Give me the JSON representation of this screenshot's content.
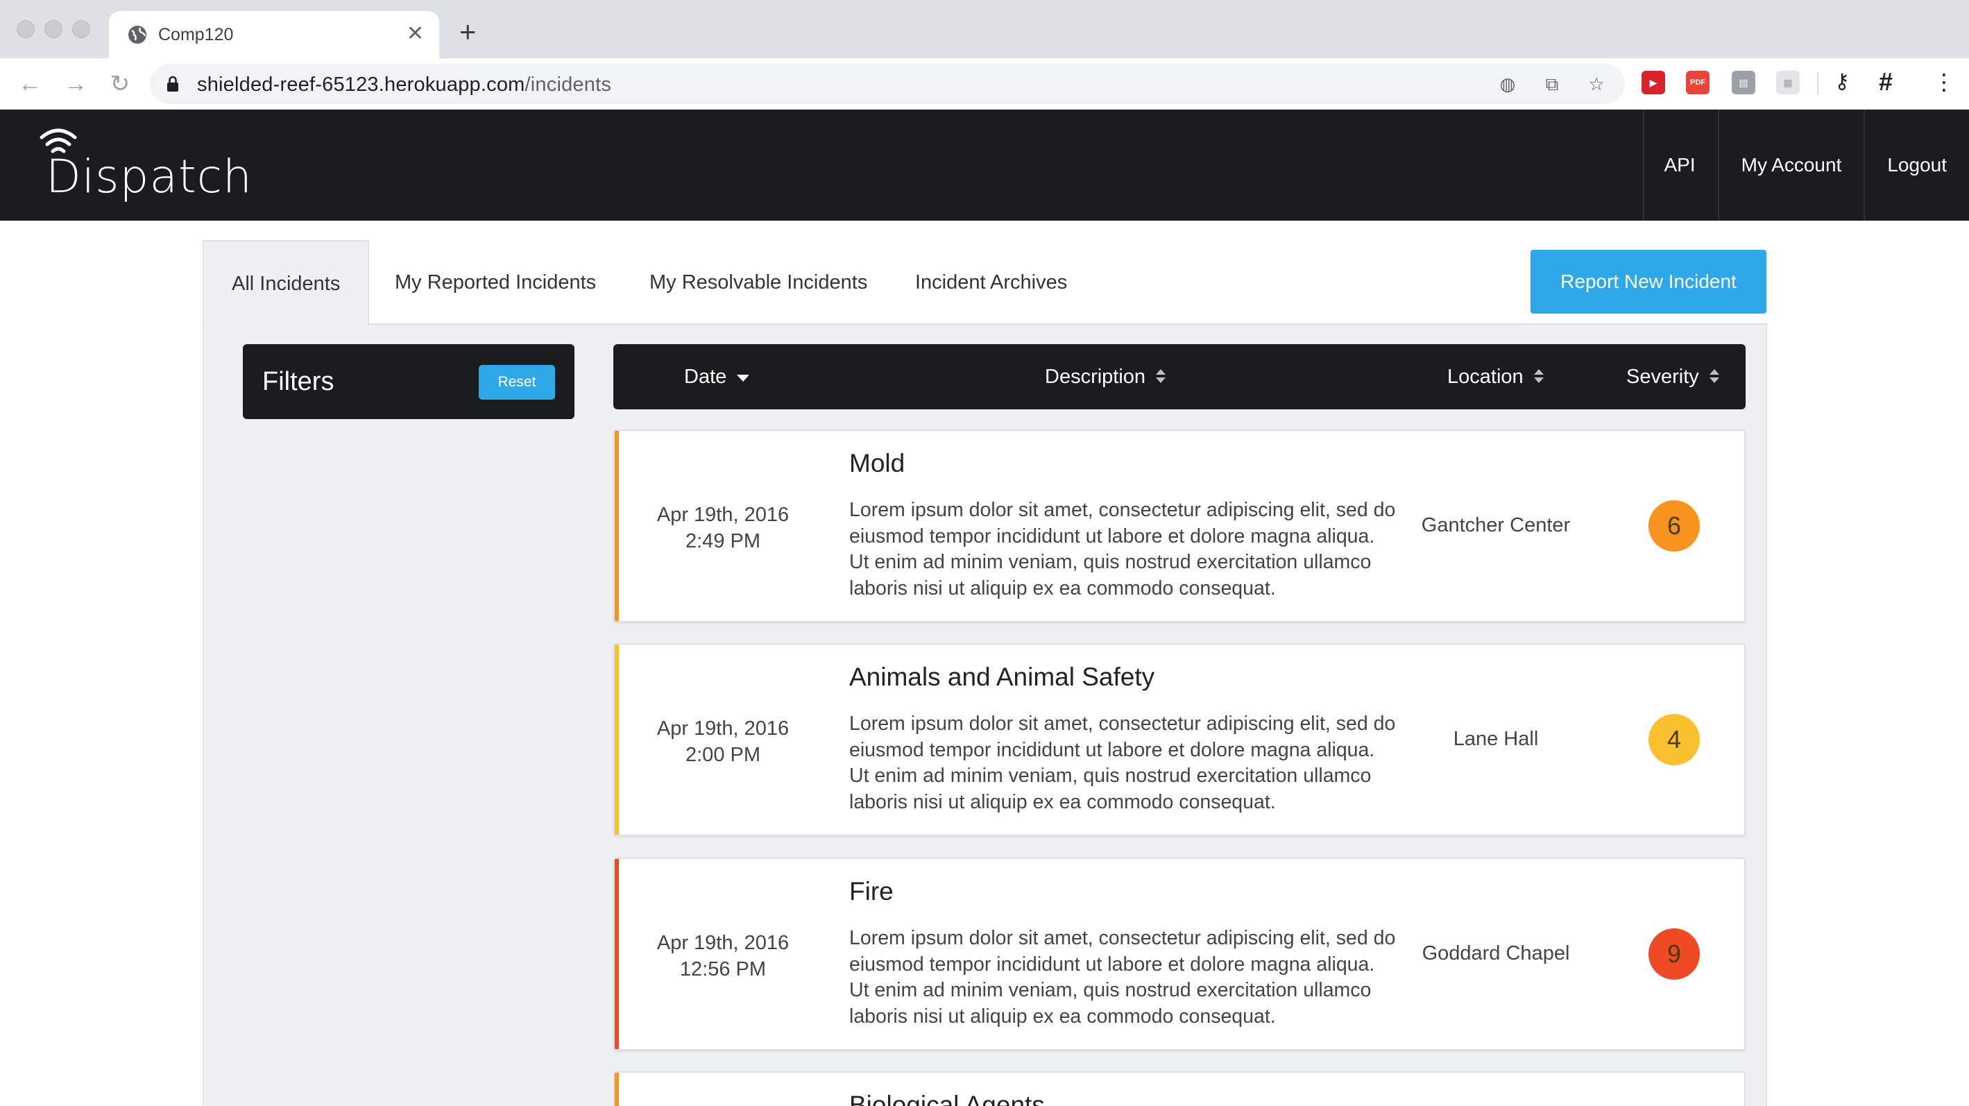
{
  "browser": {
    "tab_title": "Comp120",
    "url_host": "shielded-reef-65123.herokuapp.com",
    "url_path": "/incidents"
  },
  "header": {
    "logo": "Dispatch",
    "nav": [
      "API",
      "My Account",
      "Logout"
    ]
  },
  "tabs": {
    "all": "All Incidents",
    "reported": "My Reported Incidents",
    "resolvable": "My Resolvable Incidents",
    "archives": "Incident Archives"
  },
  "report_button": "Report New Incident",
  "filters": {
    "title": "Filters",
    "reset": "Reset"
  },
  "table": {
    "columns": {
      "date": "Date",
      "description": "Description",
      "location": "Location",
      "severity": "Severity"
    }
  },
  "incidents": [
    {
      "date": "Apr 19th, 2016",
      "time": "2:49 PM",
      "title": "Mold",
      "description": "Lorem ipsum dolor sit amet, consectetur adipiscing elit, sed do eiusmod tempor incididunt ut labore et dolore magna aliqua. Ut enim ad minim veniam, quis nostrud exercitation ullamco laboris nisi ut aliquip ex ea commodo consequat.",
      "location": "Gantcher Center",
      "severity": "6",
      "color": "#f7931e"
    },
    {
      "date": "Apr 19th, 2016",
      "time": "2:00 PM",
      "title": "Animals and Animal Safety",
      "description": "Lorem ipsum dolor sit amet, consectetur adipiscing elit, sed do eiusmod tempor incididunt ut labore et dolore magna aliqua. Ut enim ad minim veniam, quis nostrud exercitation ullamco laboris nisi ut aliquip ex ea commodo consequat.",
      "location": "Lane Hall",
      "severity": "4",
      "color": "#fbc02d"
    },
    {
      "date": "Apr 19th, 2016",
      "time": "12:56 PM",
      "title": "Fire",
      "description": "Lorem ipsum dolor sit amet, consectetur adipiscing elit, sed do eiusmod tempor incididunt ut labore et dolore magna aliqua. Ut enim ad minim veniam, quis nostrud exercitation ullamco laboris nisi ut aliquip ex ea commodo consequat.",
      "location": "Goddard Chapel",
      "severity": "9",
      "color": "#ee4a23"
    },
    {
      "title": "Biological Agents",
      "color": "#f7931e"
    }
  ],
  "colors": {
    "brand_dark": "#1b1c1d",
    "accent_blue": "#2ea8e9"
  }
}
